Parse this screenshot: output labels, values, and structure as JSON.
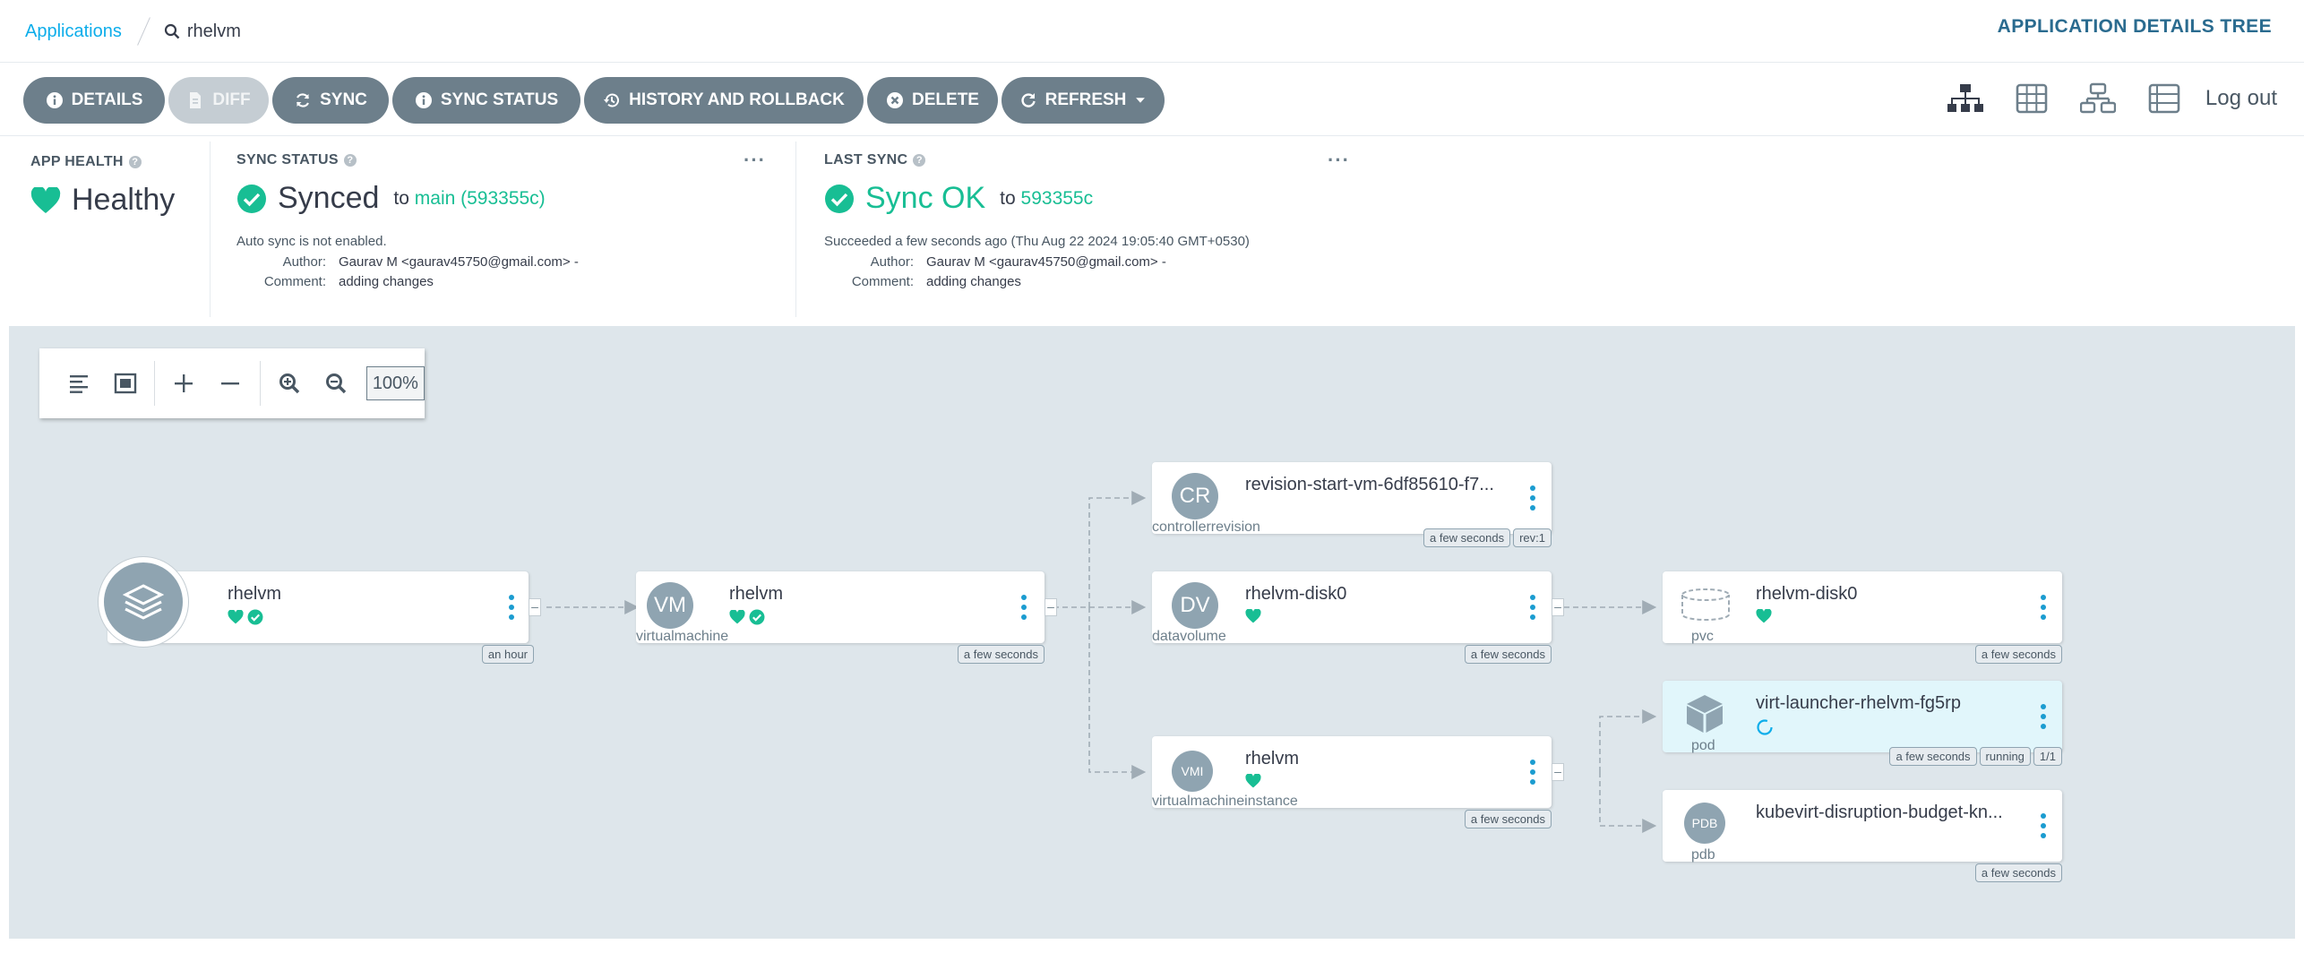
{
  "breadcrumb": {
    "root": "Applications",
    "current": "rhelvm"
  },
  "header": {
    "view_title": "APPLICATION DETAILS TREE"
  },
  "toolbar": {
    "details": "DETAILS",
    "diff": "DIFF",
    "sync": "SYNC",
    "sync_status": "SYNC STATUS",
    "history": "HISTORY AND ROLLBACK",
    "delete": "DELETE",
    "refresh": "REFRESH",
    "logout": "Log out"
  },
  "app_health": {
    "label": "APP HEALTH",
    "value": "Healthy"
  },
  "sync_status": {
    "label": "SYNC STATUS",
    "value": "Synced",
    "to": "to",
    "target": "main (593355c)",
    "note": "Auto sync is not enabled.",
    "author_label": "Author:",
    "author": "Gaurav M <gaurav45750@gmail.com> -",
    "comment_label": "Comment:",
    "comment": "adding changes",
    "more": "···"
  },
  "last_sync": {
    "label": "LAST SYNC",
    "value": "Sync OK",
    "to": "to",
    "target": "593355c",
    "note": "Succeeded a few seconds ago (Thu Aug 22 2024 19:05:40 GMT+0530)",
    "author_label": "Author:",
    "author": "Gaurav M <gaurav45750@gmail.com> -",
    "comment_label": "Comment:",
    "comment": "adding changes",
    "more": "···"
  },
  "zoom": {
    "percent": "100%"
  },
  "nodes": {
    "app": {
      "name": "rhelvm",
      "age": "an hour"
    },
    "vm": {
      "icon": "VM",
      "name": "rhelvm",
      "kind": "virtualmachine",
      "age": "a few seconds"
    },
    "cr": {
      "icon": "CR",
      "name": "revision-start-vm-6df85610-f7...",
      "kind": "controllerrevision",
      "age": "a few seconds",
      "rev": "rev:1"
    },
    "dv": {
      "icon": "DV",
      "name": "rhelvm-disk0",
      "kind": "datavolume",
      "age": "a few seconds"
    },
    "vmi": {
      "icon": "VMI",
      "name": "rhelvm",
      "kind": "virtualmachineinstance",
      "age": "a few seconds"
    },
    "pvc": {
      "name": "rhelvm-disk0",
      "kind": "pvc",
      "age": "a few seconds"
    },
    "pod": {
      "name": "virt-launcher-rhelvm-fg5rp",
      "kind": "pod",
      "age": "a few seconds",
      "state": "running",
      "ready": "1/1"
    },
    "pdb": {
      "icon": "PDB",
      "name": "kubevirt-disruption-budget-kn...",
      "kind": "pdb",
      "age": "a few seconds"
    }
  },
  "colors": {
    "healthy": "#18be94",
    "accent": "#0dadea",
    "button": "#6d7f8b",
    "canvas": "#dee6eb"
  }
}
